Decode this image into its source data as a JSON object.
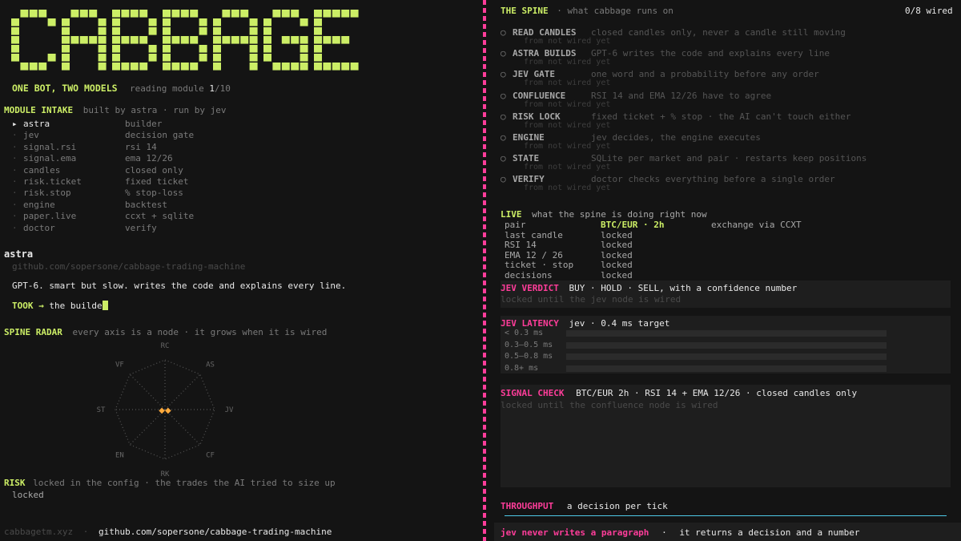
{
  "app": {
    "logo_text": "CABBAGE",
    "tagline": "ONE BOT, TWO MODELS",
    "reading_label": "reading module",
    "reading_current": "1",
    "reading_total": "/10"
  },
  "intake": {
    "title": "MODULE INTAKE",
    "subtitle": "built by astra · run by jev",
    "modules": [
      {
        "bullet": "▸",
        "name": "astra",
        "role": "builder",
        "active": true
      },
      {
        "bullet": "·",
        "name": "jev",
        "role": "decision gate"
      },
      {
        "bullet": "·",
        "name": "signal.rsi",
        "role": "rsi 14"
      },
      {
        "bullet": "·",
        "name": "signal.ema",
        "role": "ema 12/26"
      },
      {
        "bullet": "·",
        "name": "candles",
        "role": "closed only"
      },
      {
        "bullet": "·",
        "name": "risk.ticket",
        "role": "fixed ticket"
      },
      {
        "bullet": "·",
        "name": "risk.stop",
        "role": "% stop-loss"
      },
      {
        "bullet": "·",
        "name": "engine",
        "role": "backtest"
      },
      {
        "bullet": "·",
        "name": "paper.live",
        "role": "ccxt + sqlite"
      },
      {
        "bullet": "·",
        "name": "doctor",
        "role": "verify"
      }
    ]
  },
  "detail": {
    "name": "astra",
    "link": "github.com/sopersone/cabbage-trading-machine",
    "description": "GPT-6. smart but slow. writes the code and explains every line.",
    "took_label": "TOOK →",
    "took_value": "the builde"
  },
  "radar": {
    "title": "SPINE RADAR",
    "subtitle": "every axis is a node · it grows when it is wired",
    "axes": [
      "RC",
      "AS",
      "JV",
      "CF",
      "RK",
      "EN",
      "ST",
      "VF"
    ],
    "values": [
      0,
      0,
      0,
      0,
      0,
      0,
      0,
      0
    ],
    "center_glyph": "◆◆"
  },
  "risk": {
    "title": "RISK",
    "subtitle": "locked in the config · the trades the AI tried to size up",
    "value": "locked"
  },
  "footer": {
    "site": "cabbagetm.xyz",
    "sep": "·",
    "link": "github.com/sopersone/cabbage-trading-machine"
  },
  "spine": {
    "title": "THE SPINE",
    "subtitle": "· what cabbage runs on",
    "wired": "0/8 wired",
    "nodes": [
      {
        "name": "READ CANDLES",
        "desc": "closed candles only, never a candle still moving",
        "status": "from not wired yet"
      },
      {
        "name": "ASTRA BUILDS",
        "desc": "GPT-6 writes the code and explains every line",
        "status": "from not wired yet"
      },
      {
        "name": "JEV GATE",
        "desc": "one word and a probability before any order",
        "status": "from not wired yet"
      },
      {
        "name": "CONFLUENCE",
        "desc": "RSI 14 and EMA 12/26 have to agree",
        "status": "from not wired yet"
      },
      {
        "name": "RISK LOCK",
        "desc": "fixed ticket + % stop · the AI can't touch either",
        "status": "from not wired yet"
      },
      {
        "name": "ENGINE",
        "desc": "jev decides, the engine executes",
        "status": "from not wired yet"
      },
      {
        "name": "STATE",
        "desc": "SQLite per market and pair · restarts keep positions",
        "status": "from not wired yet"
      },
      {
        "name": "VERIFY",
        "desc": "doctor checks everything before a single order",
        "status": "from not wired yet"
      }
    ]
  },
  "live": {
    "title": "LIVE",
    "subtitle": "what the spine is doing right now",
    "exchange": "exchange via CCXT",
    "rows": [
      {
        "k": "pair",
        "v": "BTC/EUR · 2h"
      },
      {
        "k": "last candle",
        "v": "locked"
      },
      {
        "k": "RSI 14",
        "v": "locked"
      },
      {
        "k": "EMA 12 / 26",
        "v": "locked"
      },
      {
        "k": "ticket · stop",
        "v": "locked"
      },
      {
        "k": "decisions",
        "v": "locked"
      }
    ]
  },
  "verdict": {
    "title": "JEV VERDICT",
    "subtitle": "BUY · HOLD · SELL, with a confidence number",
    "note": "locked until the jev node is wired"
  },
  "latency": {
    "title": "JEV LATENCY",
    "subtitle": "jev · 0.4 ms target",
    "buckets": [
      {
        "label": "< 0.3 ms",
        "value": 0
      },
      {
        "label": "0.3–0.5 ms",
        "value": 0
      },
      {
        "label": "0.5–0.8 ms",
        "value": 0
      },
      {
        "label": "0.8+ ms",
        "value": 0
      }
    ]
  },
  "signal": {
    "title": "SIGNAL CHECK",
    "subtitle": "BTC/EUR 2h · RSI 14 + EMA 12/26 · closed candles only",
    "note": "locked until the confluence node is wired"
  },
  "throughput": {
    "title": "THROUGHPUT",
    "subtitle": "a decision per tick"
  },
  "bottom": {
    "title": "jev never writes a paragraph",
    "sep": "·",
    "text": "it returns a decision and a number"
  },
  "colors": {
    "accent": "#ccee66",
    "pink": "#ff3d9a",
    "background": "#141414",
    "throughput_line": "#4ec9e8"
  }
}
